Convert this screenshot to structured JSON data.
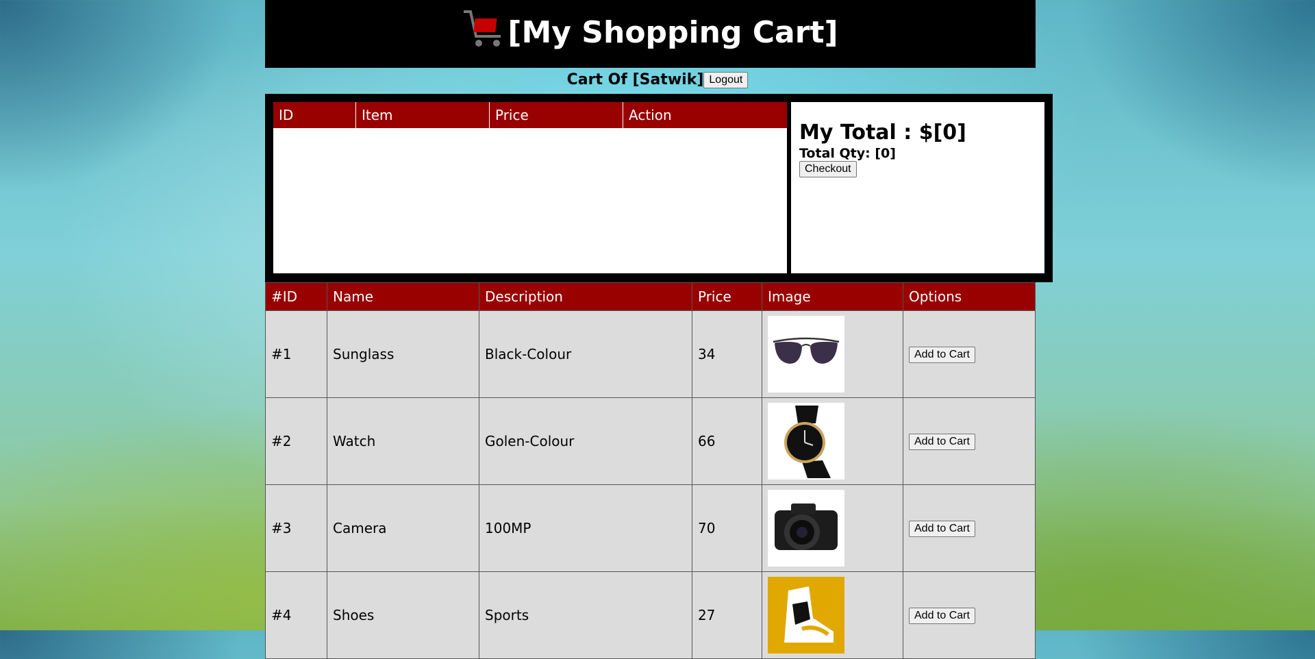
{
  "header": {
    "title": "[My Shopping Cart]"
  },
  "user_bar": {
    "label": "Cart Of [Satwik]",
    "logout_label": "Logout"
  },
  "cart": {
    "columns": [
      "ID",
      "Item",
      "Price",
      "Action"
    ],
    "total_label": "My Total : $[0]",
    "qty_label": "Total Qty: [0]",
    "checkout_label": "Checkout"
  },
  "products": {
    "columns": [
      "#ID",
      "Name",
      "Description",
      "Price",
      "Image",
      "Options"
    ],
    "rows": [
      {
        "id": "#1",
        "name": "Sunglass",
        "description": "Black-Colour",
        "price": "34",
        "image": "sunglasses-image",
        "action": "Add to Cart"
      },
      {
        "id": "#2",
        "name": "Watch",
        "description": "Golen-Colour",
        "price": "66",
        "image": "watch-image",
        "action": "Add to Cart"
      },
      {
        "id": "#3",
        "name": "Camera",
        "description": "100MP",
        "price": "70",
        "image": "camera-image",
        "action": "Add to Cart"
      },
      {
        "id": "#4",
        "name": "Shoes",
        "description": "Sports",
        "price": "27",
        "image": "shoes-image",
        "action": "Add to Cart"
      }
    ]
  },
  "colors": {
    "header_bg": "#000000",
    "table_header_bg": "#990000",
    "row_bg": "#dcdcdc"
  }
}
